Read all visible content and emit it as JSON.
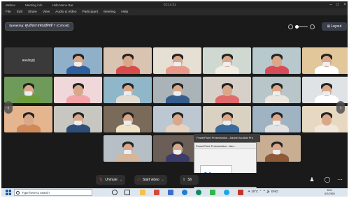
{
  "titlebar": {
    "app": "Webex",
    "meeting_info": "Meeting info",
    "meeting_name": "Hide Menu Bar",
    "clock": "01:14:21"
  },
  "menu": [
    "File",
    "Edit",
    "Share",
    "View",
    "Audio & Video",
    "Participant",
    "Meeting",
    "Help"
  ],
  "speaking": {
    "label": "Speaking: ศูนย์ขยายพันธุ์พืชที่ 7 (Cohost)"
  },
  "layout_button": "Layout",
  "gallery": {
    "noimage_name": "ลลองัญญ์",
    "tiles": [
      {
        "bg": "#3a3a3a",
        "body": "#ffffff",
        "noimg": true
      },
      {
        "bg": "#8fb0c8",
        "body": "#2e5fa0"
      },
      {
        "bg": "#d9c4b2",
        "body": "#d94b4b"
      },
      {
        "bg": "#e6dfd4",
        "body": "#e89a8a"
      },
      {
        "bg": "#cfd9d1",
        "body": "#f1ede4"
      },
      {
        "bg": "#b8c9ce",
        "body": "#d84c59"
      },
      {
        "bg": "#e2c79b",
        "body": "#ffffff"
      },
      {
        "bg": "#6e9b59",
        "body": "#6d9c3a"
      },
      {
        "bg": "#f0d7d9",
        "body": "#f4a3a8"
      },
      {
        "bg": "#8fb7c9",
        "body": "#e5dcd1"
      },
      {
        "bg": "#aab4b8",
        "body": "#365d8d"
      },
      {
        "bg": "#d6d0c8",
        "body": "#e06b6b"
      },
      {
        "bg": "#b9c6c9",
        "body": "#ebe6df"
      },
      {
        "bg": "#dfe3e5",
        "body": "#ffffff"
      },
      {
        "bg": "#e4b58f",
        "body": "#cf8a5a"
      },
      {
        "bg": "#c8c6c0",
        "body": "#2f4f7a"
      },
      {
        "bg": "#7a6a5a",
        "body": "#f0e4c8"
      },
      {
        "bg": "#bcc7d1",
        "body": "#e7d3c1"
      },
      {
        "bg": "#d9d2c3",
        "body": "#3a6a9a"
      },
      {
        "bg": "#9fb3c2",
        "body": "#e2e2e2"
      },
      {
        "bg": "#e7d8c2",
        "body": "#f1e7da"
      },
      {
        "bg": "#b7bfc6",
        "body": "#d4b79a"
      },
      {
        "bg": "#6a5e57",
        "body": "#3c3c6c"
      },
      {
        "bg": "#e1e4e6",
        "body": "#ffffff"
      },
      {
        "bg": "#c8ae92",
        "body": "#8e5a3a"
      },
      {
        "bg": "#cfd7da",
        "body": "#e76b9b"
      },
      {
        "bg": "#aec3cc",
        "body": "#f5f5f5"
      },
      {
        "bg": "#b8c4b0",
        "body": "#385d2a"
      },
      {
        "bg": "#d6dde2",
        "body": "#2e4a6e"
      },
      {
        "bg": "#dfc7a9",
        "body": "#a06a3a"
      },
      {
        "bg": "#c4c4c4",
        "body": "#ffffff"
      },
      {
        "bg": "#e3cdb7",
        "body": "#c65b3b"
      },
      {
        "bg": "#a9b9c3",
        "body": "#ffffff"
      },
      {
        "bg": "#ebe3d6",
        "body": "#5a7dab"
      },
      {
        "bg": "#c7cdc5",
        "body": "#e9e1d3"
      },
      {
        "bg": "#cdbfae",
        "body": "#ffffff"
      },
      {
        "bg": "#b5c3cb",
        "body": "#3b6f9b"
      },
      {
        "bg": "#d8dedc",
        "body": "#2c3e50"
      },
      {
        "bg": "#7b9b73",
        "body": "#eef3f5"
      },
      {
        "bg": "#e6d6c3",
        "body": "#9a4040"
      }
    ]
  },
  "presentation": {
    "tooltip": "PowerPoint Presentation - Adobe Acrobat Pro",
    "window_title": "PowerPoint Presentation - Ado...",
    "slide_number": "04",
    "slide_text": "สรุปผลการดำเนินงาน Platform Online"
  },
  "controls": {
    "unmute": "Unmute",
    "start_video": "Start video",
    "share": "Sh"
  },
  "taskbar": {
    "search_placeholder": "Type here to search",
    "weather": "25°C",
    "lang": "ENG",
    "time": "8:21",
    "date": "5/2/2565"
  }
}
